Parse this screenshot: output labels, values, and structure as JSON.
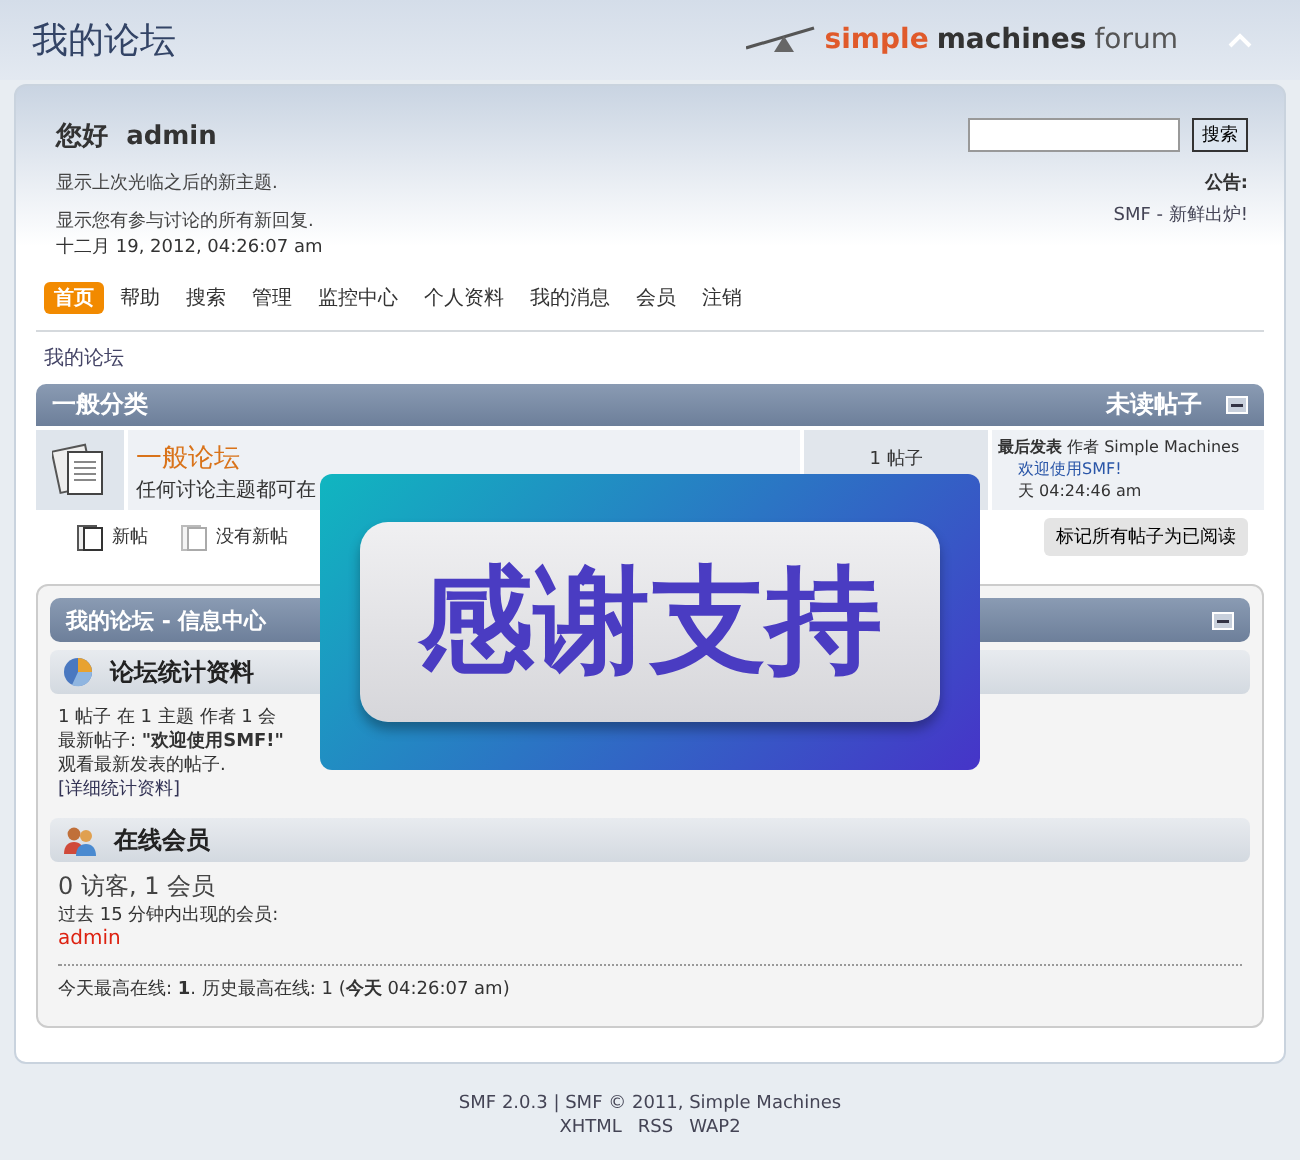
{
  "header": {
    "title": "我的论坛",
    "logo": [
      {
        "text": "simple",
        "kind": "accent"
      },
      {
        "text": "machines",
        "kind": "strong"
      },
      {
        "text": "forum",
        "kind": "plain"
      }
    ]
  },
  "user": {
    "greeting": "您好",
    "name": "admin",
    "links": [
      "显示上次光临之后的新主题.",
      "显示您有参与讨论的所有新回复."
    ],
    "date": "十二月 19, 2012, 04:26:07 am"
  },
  "search": {
    "button": "搜索"
  },
  "news": {
    "label": "公告:",
    "text": "SMF - 新鲜出炉!"
  },
  "nav": [
    {
      "label": "首页",
      "selected": true
    },
    {
      "label": "帮助",
      "selected": false
    },
    {
      "label": "搜索",
      "selected": false
    },
    {
      "label": "管理",
      "selected": false
    },
    {
      "label": "监控中心",
      "selected": false
    },
    {
      "label": "个人资料",
      "selected": false
    },
    {
      "label": "我的消息",
      "selected": false
    },
    {
      "label": "会员",
      "selected": false
    },
    {
      "label": "注销",
      "selected": false
    }
  ],
  "breadcrumb": "我的论坛",
  "category": {
    "title": "一般分类",
    "unread": "未读帖子",
    "boards": [
      {
        "name": "一般论坛",
        "description": "任何讨论主题都可在",
        "posts": "1 帖子",
        "last_post": {
          "label": "最后发表",
          "by": "作者 Simple Machines",
          "topic": "欢迎使用SMF!",
          "time": "天 04:24:46 am"
        }
      }
    ]
  },
  "legend": [
    {
      "label": "新帖",
      "kind": "new"
    },
    {
      "label": "没有新帖",
      "kind": "old"
    }
  ],
  "mark_read": "标记所有帖子为已阅读",
  "info_center": {
    "title": "我的论坛 - 信息中心",
    "sections": [
      {
        "kind": "stats",
        "title": "论坛统计资料",
        "lines": [
          "1 帖子 在 1 主题 作者 1 会",
          "最新帖子: **\"欢迎使用SMF!\"**",
          "观看最新发表的帖子."
        ],
        "link": "[详细统计资料]"
      },
      {
        "kind": "online",
        "title": "在线会员",
        "count": "0 访客, 1 会员",
        "recent_label": "过去 15 分钟内出现的会员:",
        "members": [
          "admin"
        ],
        "record": "今天最高在线: **1**. 历史最高在线: 1 (**今天** 04:26:07 am)"
      }
    ]
  },
  "overlay": {
    "text": "感谢支持"
  },
  "footer": {
    "line": "SMF 2.0.3 | SMF © 2011, Simple Machines",
    "links": [
      "XHTML",
      "RSS",
      "WAP2"
    ]
  }
}
